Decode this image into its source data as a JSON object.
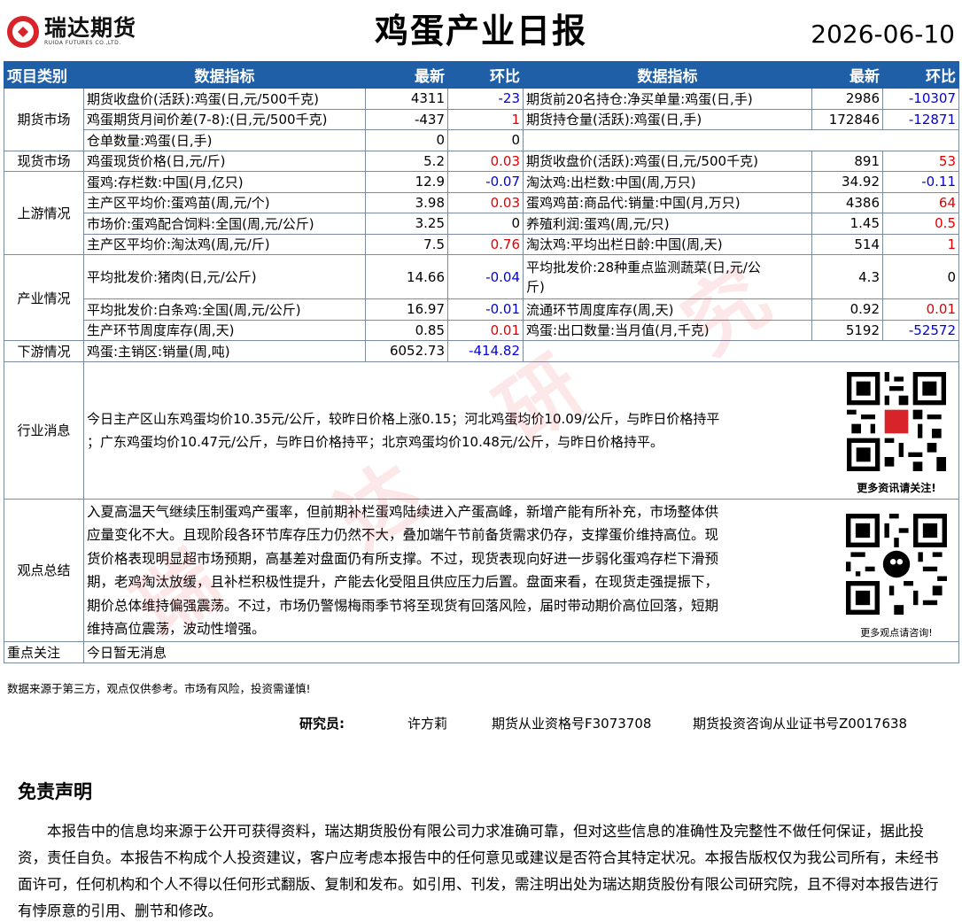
{
  "header": {
    "logo_cn": "瑞达期货",
    "logo_en": "RUIDA FUTURES CO.,LTD.",
    "title": "鸡蛋产业日报",
    "date": "2026-06-10"
  },
  "table_header": {
    "category": "项目类别",
    "indicator": "数据指标",
    "latest": "最新",
    "change": "环比",
    "indicator2": "数据指标",
    "latest2": "最新",
    "change2": "环比"
  },
  "categories": {
    "futures": "期货市场",
    "spot": "现货市场",
    "upstream": "上游情况",
    "industry": "产业情况",
    "downstream": "下游情况",
    "news": "行业消息",
    "view": "观点总结",
    "focus": "重点关注"
  },
  "rows": {
    "futures": [
      {
        "n1": "期货收盘价(活跃):鸡蛋(日,元/500千克)",
        "v1": "4311",
        "c1": "-23",
        "n2": "期货前20名持仓:净买单量:鸡蛋(日,手)",
        "v2": "2986",
        "c2": "-10307"
      },
      {
        "n1": "鸡蛋期货月间价差(7-8):(日,元/500千克)",
        "v1": "-437",
        "c1": "1",
        "n2": "期货持仓量(活跃):鸡蛋(日,手)",
        "v2": "172846",
        "c2": "-12871"
      },
      {
        "n1": "仓单数量:鸡蛋(日,手)",
        "v1": "0",
        "c1": "0",
        "n2": "",
        "v2": "",
        "c2": ""
      }
    ],
    "spot": [
      {
        "n1": "鸡蛋现货价格(日,元/斤)",
        "v1": "5.2",
        "c1": "0.03",
        "n2": "期货收盘价(活跃):鸡蛋(日,元/500千克)",
        "v2": "891",
        "c2": "53"
      }
    ],
    "upstream": [
      {
        "n1": "蛋鸡:存栏数:中国(月,亿只)",
        "v1": "12.9",
        "c1": "-0.07",
        "n2": "淘汰鸡:出栏数:中国(周,万只)",
        "v2": "34.92",
        "c2": "-0.11"
      },
      {
        "n1": "主产区平均价:蛋鸡苗(周,元/个)",
        "v1": "3.98",
        "c1": "0.03",
        "n2": "蛋鸡鸡苗:商品代:销量:中国(月,万只)",
        "v2": "4386",
        "c2": "64"
      },
      {
        "n1": "市场价:蛋鸡配合饲料:全国(周,元/公斤)",
        "v1": "3.25",
        "c1": "0",
        "n2": "养殖利润:蛋鸡(周,元/只)",
        "v2": "1.45",
        "c2": "0.5"
      },
      {
        "n1": "主产区平均价:淘汰鸡(周,元/斤)",
        "v1": "7.5",
        "c1": "0.76",
        "n2": "淘汰鸡:平均出栏日龄:中国(周,天)",
        "v2": "514",
        "c2": "1"
      }
    ],
    "industry": [
      {
        "n1": "平均批发价:猪肉(日,元/公斤)",
        "v1": "14.66",
        "c1": "-0.04",
        "n2a": "平均批发价:28种重点监测蔬菜(日,元/公",
        "n2b": "斤)",
        "v2": "4.3",
        "c2": "0"
      },
      {
        "n1": "平均批发价:白条鸡:全国(周,元/公斤)",
        "v1": "16.97",
        "c1": "-0.01",
        "n2": "流通环节周度库存(周,天)",
        "v2": "0.92",
        "c2": "0.01"
      },
      {
        "n1": "生产环节周度库存(周,天)",
        "v1": "0.85",
        "c1": "0.01",
        "n2": "鸡蛋:出口数量:当月值(月,千克)",
        "v2": "5192",
        "c2": "-52572"
      }
    ],
    "downstream": [
      {
        "n1": "鸡蛋:主销区:销量(周,吨)",
        "v1": "6052.73",
        "c1": "-414.82"
      }
    ]
  },
  "news": {
    "line1": "今日主产区山东鸡蛋均价10.35元/公斤，较昨日价格上涨0.15；河北鸡蛋均价10.09/公斤，与昨日价格持平",
    "line2": "；广东鸡蛋均价10.47元/公斤，与昨日价格持平；北京鸡蛋均价10.48元/公斤，与昨日价格持平。"
  },
  "view": {
    "lines": [
      "入夏高温天气继续压制蛋鸡产蛋率，但前期补栏蛋鸡陆续进入产蛋高峰，新增产能有所补充，市场整体供",
      "应量变化不大。且现阶段各环节库存压力仍然不大，叠加端午节前备货需求仍存，支撑蛋价维持高位。现",
      "货价格表现明显超市场预期，高基差对盘面仍有所支撑。不过，现货表现向好进一步弱化蛋鸡存栏下滑预",
      "期，老鸡淘汰放缓，且补栏积极性提升，产能去化受阻且供应压力后置。盘面来看，在现货走强提振下，",
      "期价总体维持偏强震荡。不过，市场仍警惕梅雨季节将至现货有回落风险，届时带动期价高位回落，短期",
      "维持高位震荡，波动性增强。"
    ]
  },
  "focus": {
    "text": "今日暂无消息"
  },
  "qr": {
    "caption1": "更多资讯请关注!",
    "caption2": "更多观点请咨询!"
  },
  "watermark": {
    "w1": "瑞",
    "w2": "达",
    "w3": "研",
    "w4": "究"
  },
  "footer": {
    "note": "数据来源于第三方，观点仅供参考。市场有风险，投资需谨慎!",
    "researcher_label": "研究员:",
    "researcher_name": "许方莉",
    "license1": "期货从业资格号F3073708",
    "license2": "期货投资咨询从业证书号Z0017638"
  },
  "disclaimer": {
    "title": "免责声明",
    "body": "本报告中的信息均来源于公开可获得资料，瑞达期货股份有限公司力求准确可靠，但对这些信息的准确性及完整性不做任何保证，据此投资，责任自负。本报告不构成个人投资建议，客户应考虑本报告中的任何意见或建议是否符合其特定状况。本报告版权仅为我公司所有，未经书面许可，任何机构和个人不得以任何形式翻版、复制和发布。如引用、刊发，需注明出处为瑞达期货股份有限公司研究院，且不得对本报告进行有悖原意的引用、删节和修改。"
  },
  "colors": {
    "header_blue": "#1f5fa8",
    "positive": "#e00000",
    "negative": "#0000e0",
    "logo_red": "#d9232a"
  }
}
